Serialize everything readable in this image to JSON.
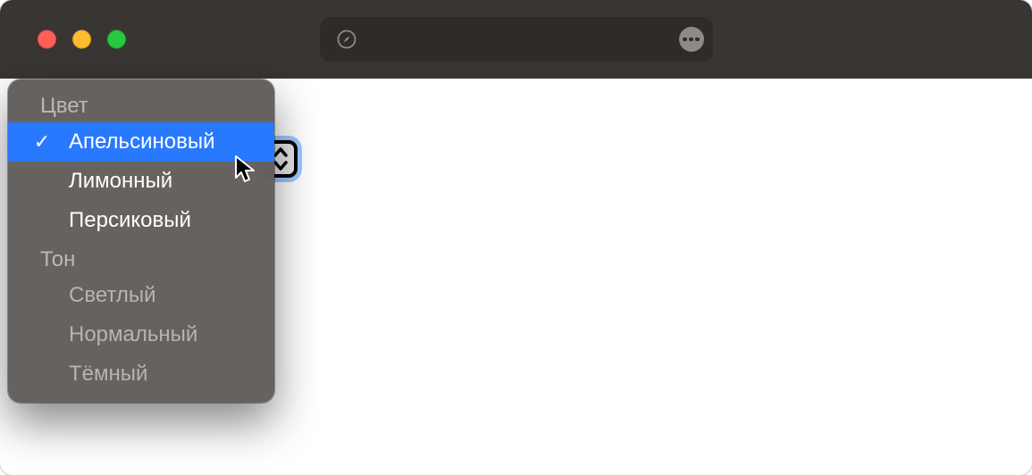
{
  "window": {
    "address_value": "",
    "address_placeholder": ""
  },
  "select": {
    "groups": [
      {
        "label": "Цвет",
        "items": [
          {
            "label": "Апельсиновый",
            "selected": true,
            "disabled": false
          },
          {
            "label": "Лимонный",
            "selected": false,
            "disabled": false
          },
          {
            "label": "Персиковый",
            "selected": false,
            "disabled": false
          }
        ]
      },
      {
        "label": "Тон",
        "items": [
          {
            "label": "Светлый",
            "selected": false,
            "disabled": true
          },
          {
            "label": "Нормальный",
            "selected": false,
            "disabled": true
          },
          {
            "label": "Тёмный",
            "selected": false,
            "disabled": true
          }
        ]
      }
    ]
  }
}
